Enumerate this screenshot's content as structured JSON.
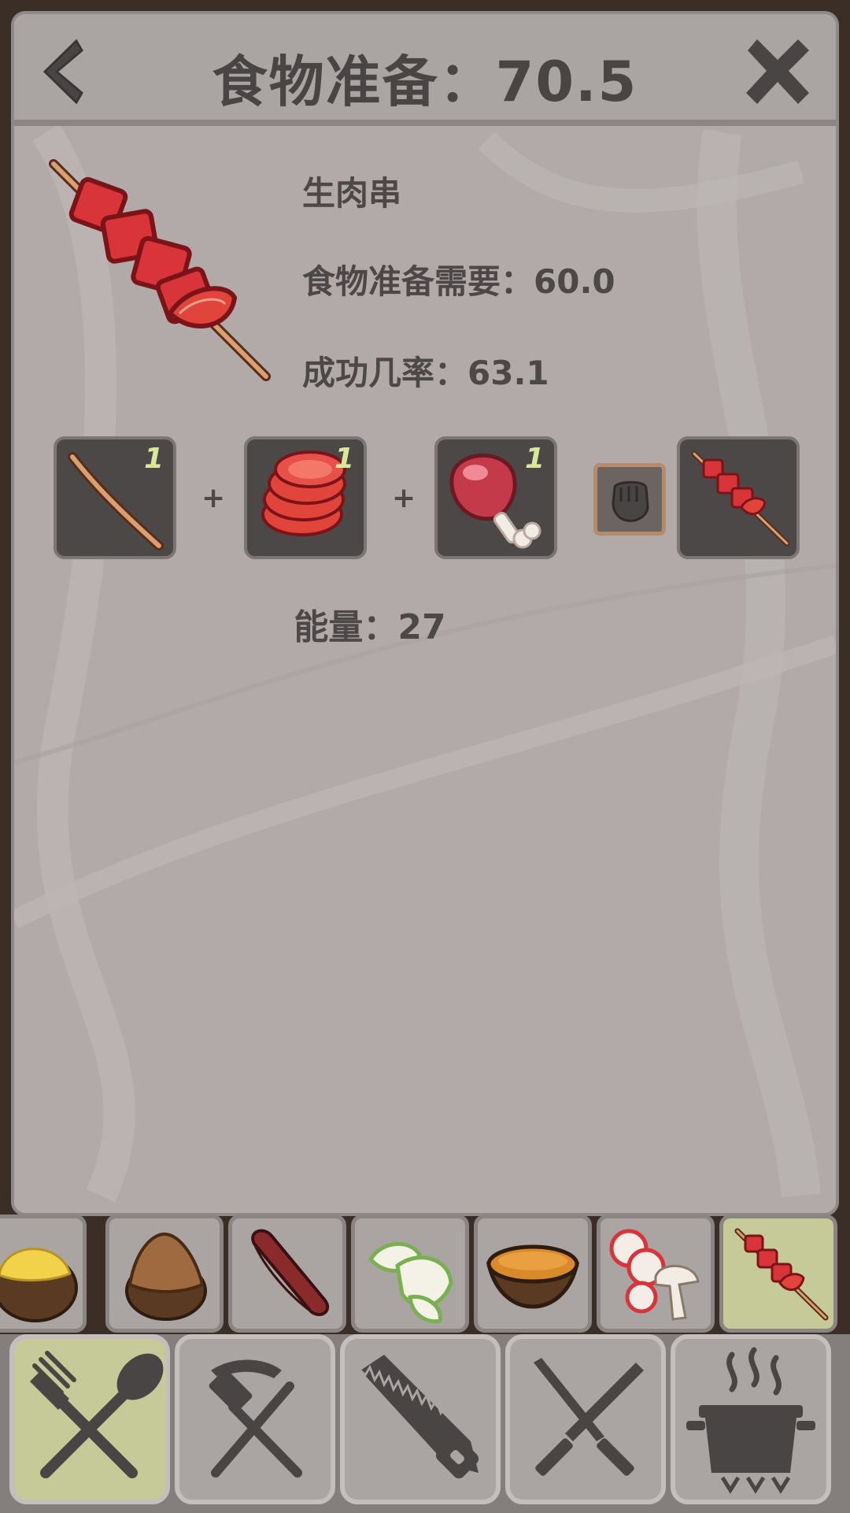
{
  "header": {
    "title": "食物准备：70.5",
    "back_icon": "chevron-left-icon",
    "close_icon": "close-x-icon"
  },
  "recipe": {
    "name": "生肉串",
    "requirement": "食物准备需要：60.0",
    "success_rate": "成功几率：63.1",
    "energy": "能量：27"
  },
  "ingredients": [
    {
      "icon": "stick-icon",
      "quantity": "1"
    },
    {
      "icon": "tomato-slices-icon",
      "quantity": "1"
    },
    {
      "icon": "raw-meat-icon",
      "quantity": "1"
    }
  ],
  "operators": [
    "+",
    "+"
  ],
  "craft_button_icon": "fist-icon",
  "result_icon": "meat-skewer-icon",
  "recipe_strip": [
    {
      "icon": "coconut-with-custard-icon",
      "selected": false
    },
    {
      "icon": "roasted-coconut-icon",
      "selected": false
    },
    {
      "icon": "sausage-icon",
      "selected": false
    },
    {
      "icon": "apple-slices-icon",
      "selected": false
    },
    {
      "icon": "coconut-soup-icon",
      "selected": false
    },
    {
      "icon": "mushroom-radish-slices-icon",
      "selected": false
    },
    {
      "icon": "meat-skewer-icon",
      "selected": true
    }
  ],
  "tabs": [
    {
      "icon": "fork-spoon-icon",
      "selected": true
    },
    {
      "icon": "pickaxe-hammer-icon",
      "selected": false
    },
    {
      "icon": "saw-icon",
      "selected": false
    },
    {
      "icon": "crossed-knives-icon",
      "selected": false
    },
    {
      "icon": "cooking-pot-icon",
      "selected": false
    }
  ],
  "colors": {
    "panel": "#b1aaa9",
    "text": "#4d4848",
    "quantity": "#d9e79a",
    "selected": "#c6c998",
    "meat": "#d8343a"
  }
}
